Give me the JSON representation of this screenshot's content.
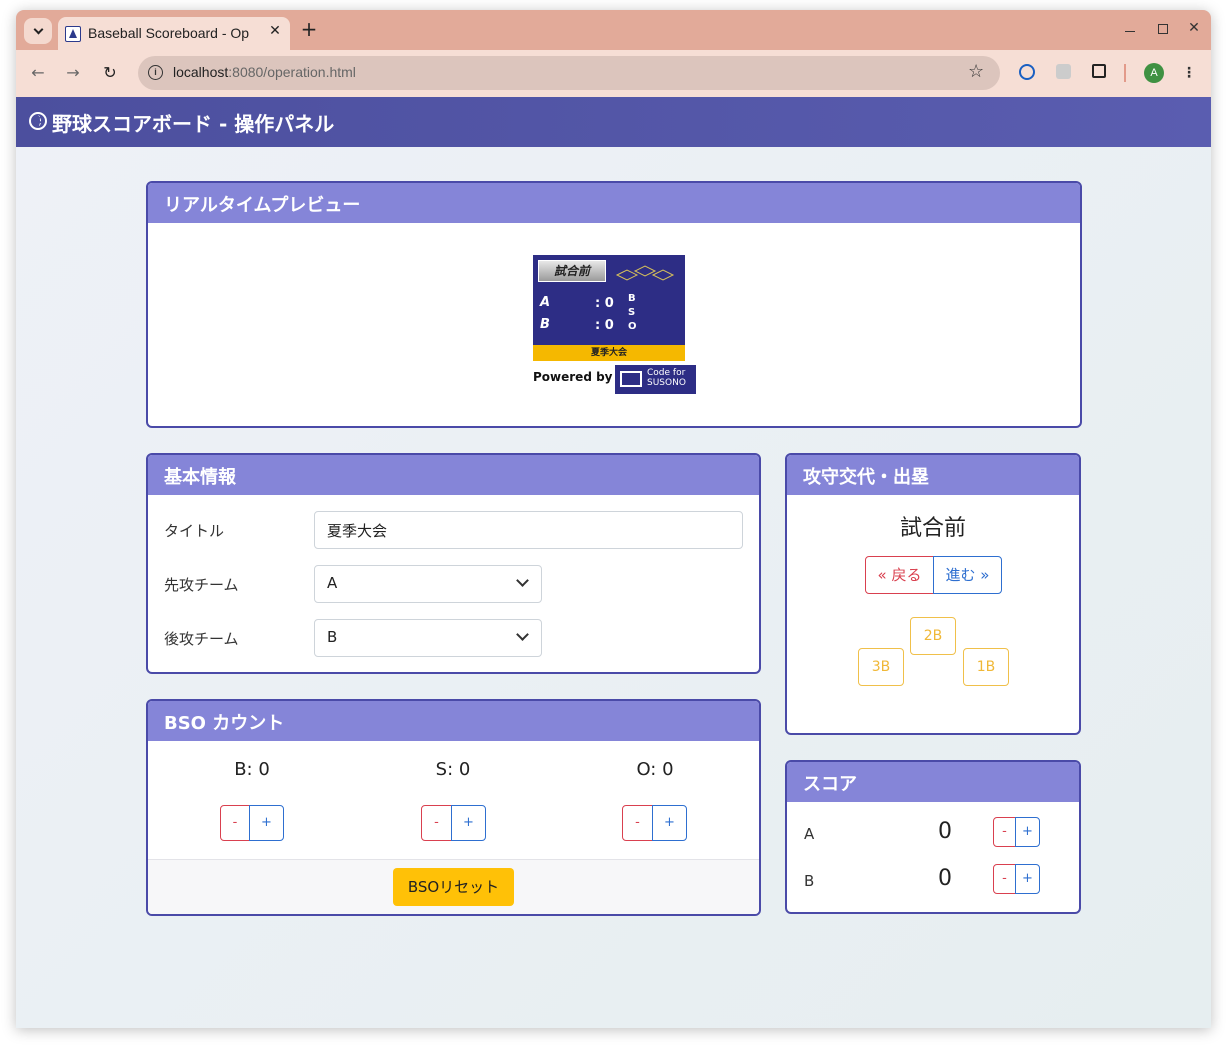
{
  "browser": {
    "tab_title": "Baseball Scoreboard - Op",
    "tab_close": "✕",
    "new_tab": "+",
    "url_host": "localhost",
    "url_path": ":8080/operation.html",
    "avatar_letter": "A"
  },
  "app": {
    "title": "野球スコアボード - 操作パネル"
  },
  "preview": {
    "header": "リアルタイムプレビュー",
    "status": "試合前",
    "team_a": "A",
    "team_b": "B",
    "score_a": ": 0",
    "score_b": ": 0",
    "b_letter": "B",
    "s_letter": "S",
    "o_letter": "O",
    "title": "夏季大会",
    "powered_by": "Powered by",
    "logo_line1": "Code for",
    "logo_line2": "SUSONO"
  },
  "basic_info": {
    "header": "基本情報",
    "title_label": "タイトル",
    "title_value": "夏季大会",
    "first_team_label": "先攻チーム",
    "first_team_value": "A",
    "second_team_label": "後攻チーム",
    "second_team_value": "B"
  },
  "bso": {
    "header": "BSO カウント",
    "ball": "B: 0",
    "strike": "S: 0",
    "out": "O: 0",
    "minus": "-",
    "plus": "+",
    "reset": "BSOリセット"
  },
  "inning": {
    "header": "攻守交代・出塁",
    "status": "試合前",
    "back": "« 戻る",
    "forward": "進む »",
    "second": "2B",
    "third": "3B",
    "first": "1B"
  },
  "score": {
    "header": "スコア",
    "rows": [
      {
        "team": "A",
        "value": "0"
      },
      {
        "team": "B",
        "value": "0"
      }
    ],
    "minus": "-",
    "plus": "+"
  },
  "colors": {
    "navbar": "#4c4f9e",
    "card_header": "#8585d8",
    "card_border": "#4a4aa8",
    "warning": "#ffc107",
    "danger": "#d9404f",
    "primary": "#2e6fd0"
  }
}
